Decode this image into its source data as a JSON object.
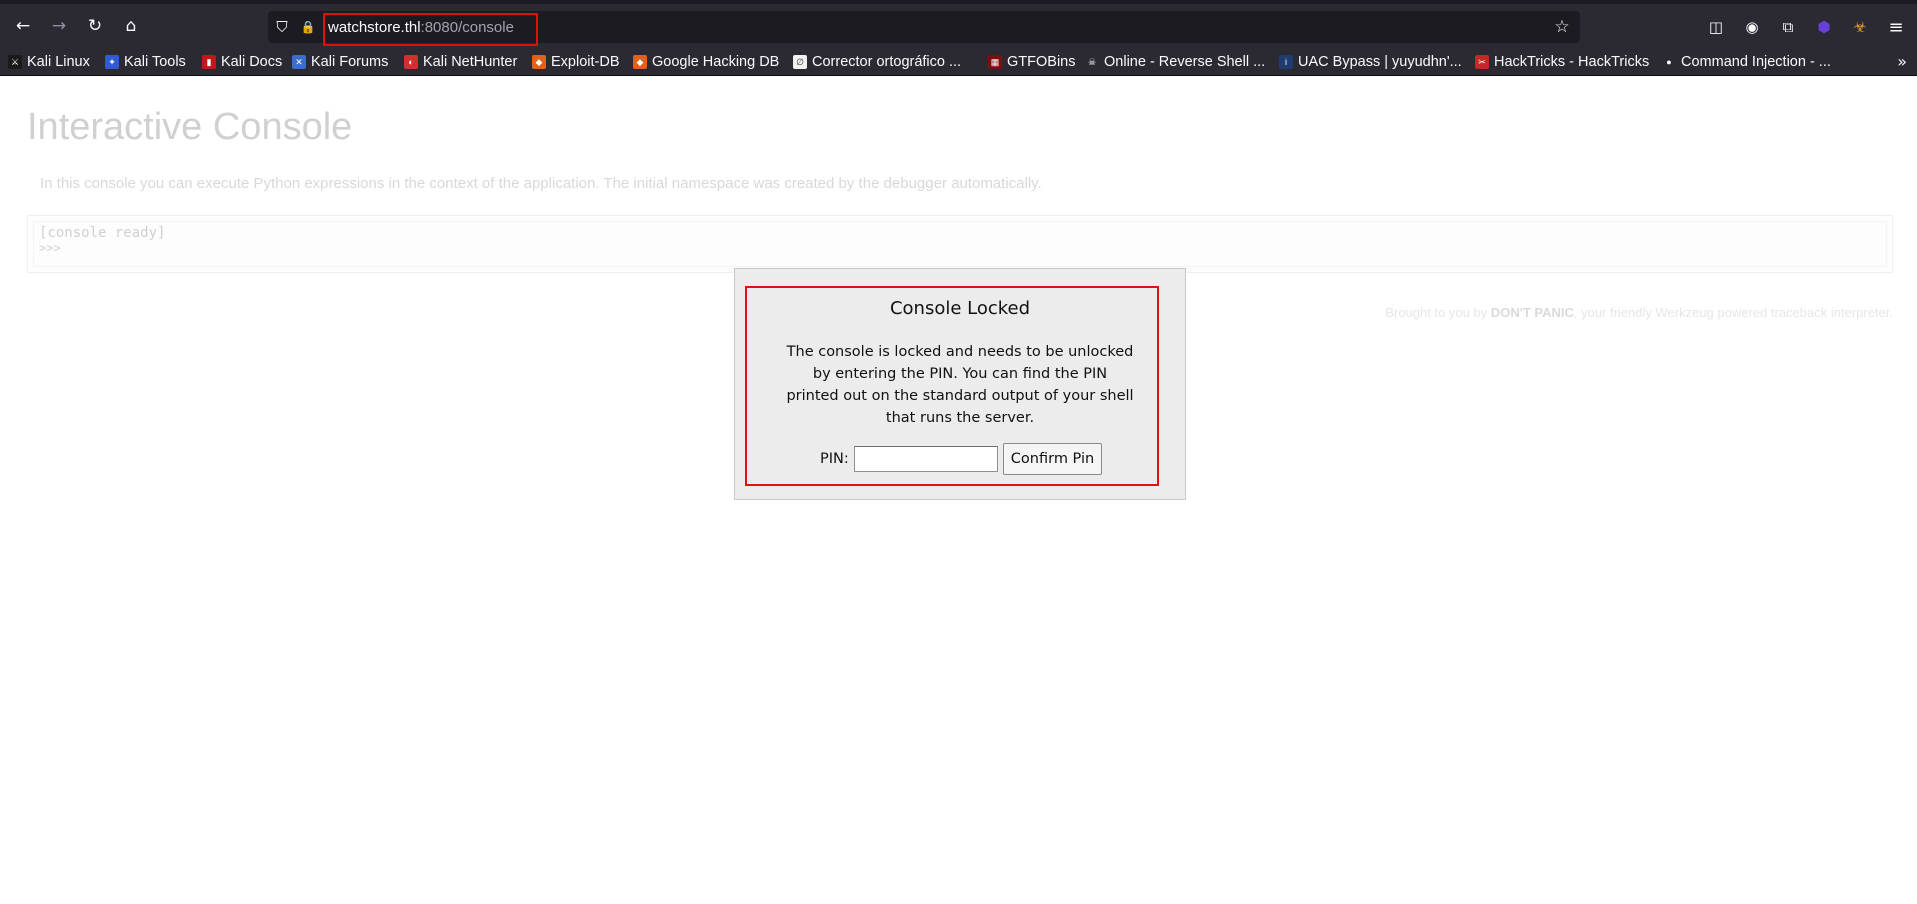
{
  "browser": {
    "url_host": "watchstore.thl",
    "url_path": ":8080/console",
    "icons": {
      "back": "←",
      "forward": "→",
      "reload": "↻",
      "home": "⌂",
      "shield": "⛉",
      "lock": "🔒",
      "star": "☆",
      "pocket": "◫",
      "account": "◉",
      "extensions": "⧉",
      "ext1": "⬢",
      "ext2": "☣",
      "menu": "≡",
      "more": "»"
    }
  },
  "bookmarks": [
    {
      "label": "Kali Linux",
      "icon": "⚔",
      "color": "#1a1a1a"
    },
    {
      "label": "Kali Tools",
      "icon": "✦",
      "color": "#2f5bd3"
    },
    {
      "label": "Kali Docs",
      "icon": "▮",
      "color": "#c01818"
    },
    {
      "label": "Kali Forums",
      "icon": "✕",
      "color": "#3a6ec8"
    },
    {
      "label": "Kali NetHunter",
      "icon": "◐",
      "color": "#d23030"
    },
    {
      "label": "Exploit-DB",
      "icon": "◆",
      "color": "#e0601c"
    },
    {
      "label": "Google Hacking DB",
      "icon": "◆",
      "color": "#e0601c"
    },
    {
      "label": "Corrector ortográfico ...",
      "icon": "∅",
      "color": "#f2f2f2"
    },
    {
      "label": "GTFOBins",
      "icon": "▦",
      "color": "#7a1010"
    },
    {
      "label": "Online - Reverse Shell ...",
      "icon": "☠",
      "color": "#2b2a33"
    },
    {
      "label": "UAC Bypass | yuyudhn'...",
      "icon": "i",
      "color": "#1e3c6e"
    },
    {
      "label": "HackTricks - HackTricks",
      "icon": "✂",
      "color": "#c62828"
    },
    {
      "label": "Command Injection - ...",
      "icon": "●",
      "color": "#2b2a33"
    }
  ],
  "page": {
    "title": "Interactive Console",
    "intro": "In this console you can execute Python expressions in the context of the application. The initial namespace was created by the debugger automatically.",
    "console_ready": "[console ready]",
    "prompt": ">>>",
    "footer_prefix": "Brought to you by ",
    "footer_brand": "DON'T PANIC",
    "footer_suffix": ", your friendly Werkzeug powered traceback interpreter."
  },
  "modal": {
    "title": "Console Locked",
    "text": "The console is locked and needs to be unlocked by entering the PIN. You can find the PIN printed out on the standard output of your shell that runs the server.",
    "pin_label": "PIN:",
    "pin_value": "",
    "confirm_label": "Confirm Pin"
  },
  "colors": {
    "highlight": "#e01010",
    "chrome_bg": "#2b2a33",
    "urlbar_bg": "#1c1b22"
  }
}
